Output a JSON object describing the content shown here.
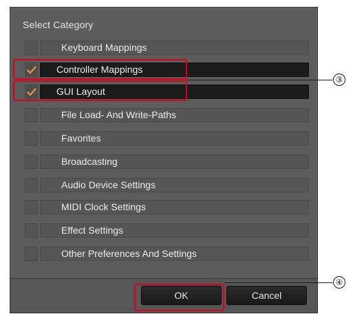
{
  "dialog": {
    "title": "Select Category",
    "categories": [
      {
        "label": "Keyboard Mappings",
        "checked": false
      },
      {
        "label": "Controller Mappings",
        "checked": true
      },
      {
        "label": "GUI Layout",
        "checked": true
      },
      {
        "label": "File Load- And Write-Paths",
        "checked": false
      },
      {
        "label": "Favorites",
        "checked": false
      },
      {
        "label": "Broadcasting",
        "checked": false
      },
      {
        "label": "Audio Device Settings",
        "checked": false
      },
      {
        "label": "MIDI Clock Settings",
        "checked": false
      },
      {
        "label": "Effect Settings",
        "checked": false
      },
      {
        "label": "Other Preferences And Settings",
        "checked": false
      }
    ],
    "buttons": {
      "ok_label": "OK",
      "cancel_label": "Cancel"
    }
  },
  "callouts": {
    "categories_marker": "③",
    "ok_marker": "④"
  },
  "colors": {
    "dialog_bg": "#5c5c5c",
    "checked_row_bg": "#1b1b1b",
    "checkmark": "#f08a3c",
    "callout_border": "#d9001b"
  }
}
